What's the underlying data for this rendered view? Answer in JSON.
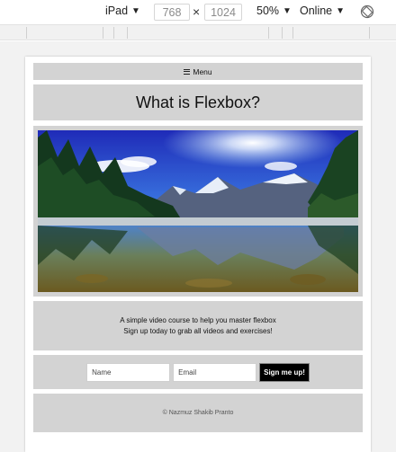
{
  "devtools": {
    "device": "iPad",
    "width": "768",
    "times": "×",
    "height": "1024",
    "zoom": "50%",
    "network": "Online",
    "rotate_icon": "rotate-icon",
    "caret_icon": "caret-down-icon"
  },
  "page": {
    "menu_label": "Menu",
    "menu_icon": "hamburger-icon",
    "title": "What is Flexbox?",
    "hero_image": "mountain-lake-landscape",
    "description": [
      "A simple video course to help you master flexbox",
      "Sign up today to grab all videos and exercises!"
    ],
    "form": {
      "name_placeholder": "Name",
      "email_placeholder": "Email",
      "submit_label": "Sign me up!"
    },
    "footer": "© Nazmuz Shakib Pranto"
  },
  "colors": {
    "block_bg": "#d3d3d3",
    "button_bg": "#000000",
    "stage_bg": "#f2f2f2"
  }
}
